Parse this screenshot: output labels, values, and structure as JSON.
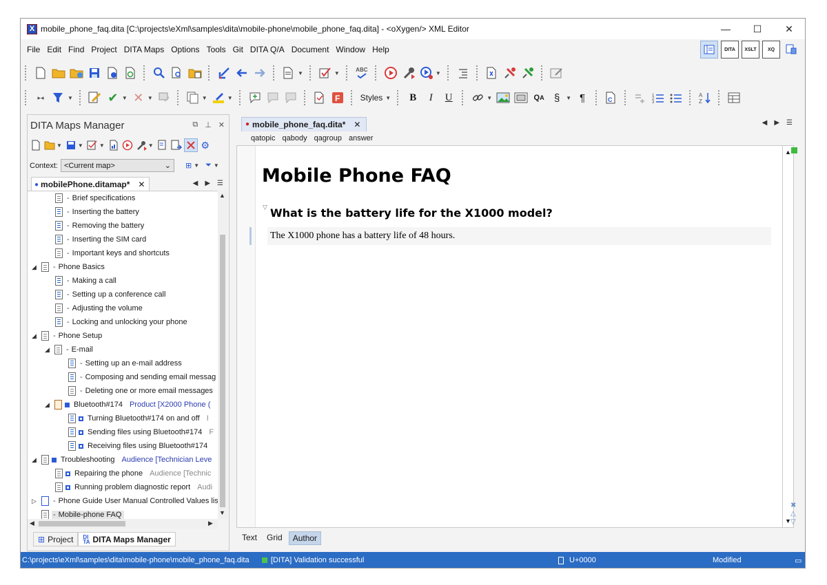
{
  "window": {
    "title": "mobile_phone_faq.dita [C:\\projects\\eXml\\samples\\dita\\mobile-phone\\mobile_phone_faq.dita] - <oXygen/> XML Editor",
    "controls": {
      "minimize": "—",
      "maximize": "☐",
      "close": "✕"
    }
  },
  "menu": [
    "File",
    "Edit",
    "Find",
    "Project",
    "DITA Maps",
    "Options",
    "Tools",
    "Git",
    "DITA Q/A",
    "Document",
    "Window",
    "Help"
  ],
  "perspectives": [
    "editor-perspective-icon",
    "DITA",
    "XSLT",
    "XQ",
    "database-perspective-icon"
  ],
  "toolbar2": {
    "styles_label": "Styles"
  },
  "left_panel": {
    "title": "DITA Maps Manager",
    "context_label": "Context:",
    "context_value": "<Current map>",
    "map_tab": "mobilePhone.ditamap*",
    "tree": [
      {
        "label": "Brief specifications",
        "indent": 2
      },
      {
        "label": "Inserting the battery",
        "indent": 2
      },
      {
        "label": "Removing the battery",
        "indent": 2
      },
      {
        "label": "Inserting the SIM card",
        "indent": 2
      },
      {
        "label": "Important keys and shortcuts",
        "indent": 2
      },
      {
        "label": "Phone Basics",
        "indent": 1
      },
      {
        "label": "Making a call",
        "indent": 2
      },
      {
        "label": "Setting up a conference call",
        "indent": 2
      },
      {
        "label": "Adjusting the volume",
        "indent": 2
      },
      {
        "label": "Locking and unlocking your phone",
        "indent": 2
      },
      {
        "label": "Phone Setup",
        "indent": 1
      },
      {
        "label": "E-mail",
        "indent": 2
      },
      {
        "label": "Setting up an e-mail address",
        "indent": 3
      },
      {
        "label": "Composing and sending email messag",
        "indent": 3
      },
      {
        "label": "Deleting one or more email messages",
        "indent": 3
      },
      {
        "label": "Bluetooth#174",
        "indent": 2,
        "prop": "Product [X2000 Phone (",
        "prop_style": "blue"
      },
      {
        "label": "Turning Bluetooth#174 on and off",
        "indent": 3,
        "prop": "I",
        "prop_style": "gray"
      },
      {
        "label": "Sending files using Bluetooth#174",
        "indent": 3,
        "prop": "F",
        "prop_style": "gray"
      },
      {
        "label": "Receiving files using Bluetooth#174",
        "indent": 3,
        "prop": "",
        "prop_style": "gray"
      },
      {
        "label": "Troubleshooting",
        "indent": 1,
        "prop": "Audience [Technician Leve",
        "prop_style": "blue"
      },
      {
        "label": "Repairing the phone",
        "indent": 2,
        "prop": "Audience [Technic",
        "prop_style": "gray"
      },
      {
        "label": "Running problem diagnostic report",
        "indent": 2,
        "prop": "Audi",
        "prop_style": "gray"
      },
      {
        "label": "Phone Guide User Manual Controlled Values lis",
        "indent": 1
      },
      {
        "label": "Mobile-phone FAQ",
        "indent": 1
      }
    ],
    "bottom_tabs": [
      "Project",
      "DITA Maps Manager"
    ]
  },
  "editor": {
    "tab": "mobile_phone_faq.dita*",
    "breadcrumbs": [
      "qatopic",
      "qabody",
      "qagroup",
      "answer"
    ],
    "doc_title": "Mobile Phone FAQ",
    "question": "What is the battery life for the X1000 model?",
    "answer": "The X1000 phone has a battery life of 48 hours.",
    "modes": [
      "Text",
      "Grid",
      "Author"
    ],
    "active_mode": "Author"
  },
  "status": {
    "path": "C:\\projects\\eXml\\samples\\dita\\mobile-phone\\mobile_phone_faq.dita",
    "validation": "[DITA] Validation successful",
    "unicode": "U+0000",
    "modified": "Modified"
  },
  "colors": {
    "accent": "#2b6cc4",
    "valid": "#4cc44c",
    "link_blue": "#2b3bb0"
  }
}
